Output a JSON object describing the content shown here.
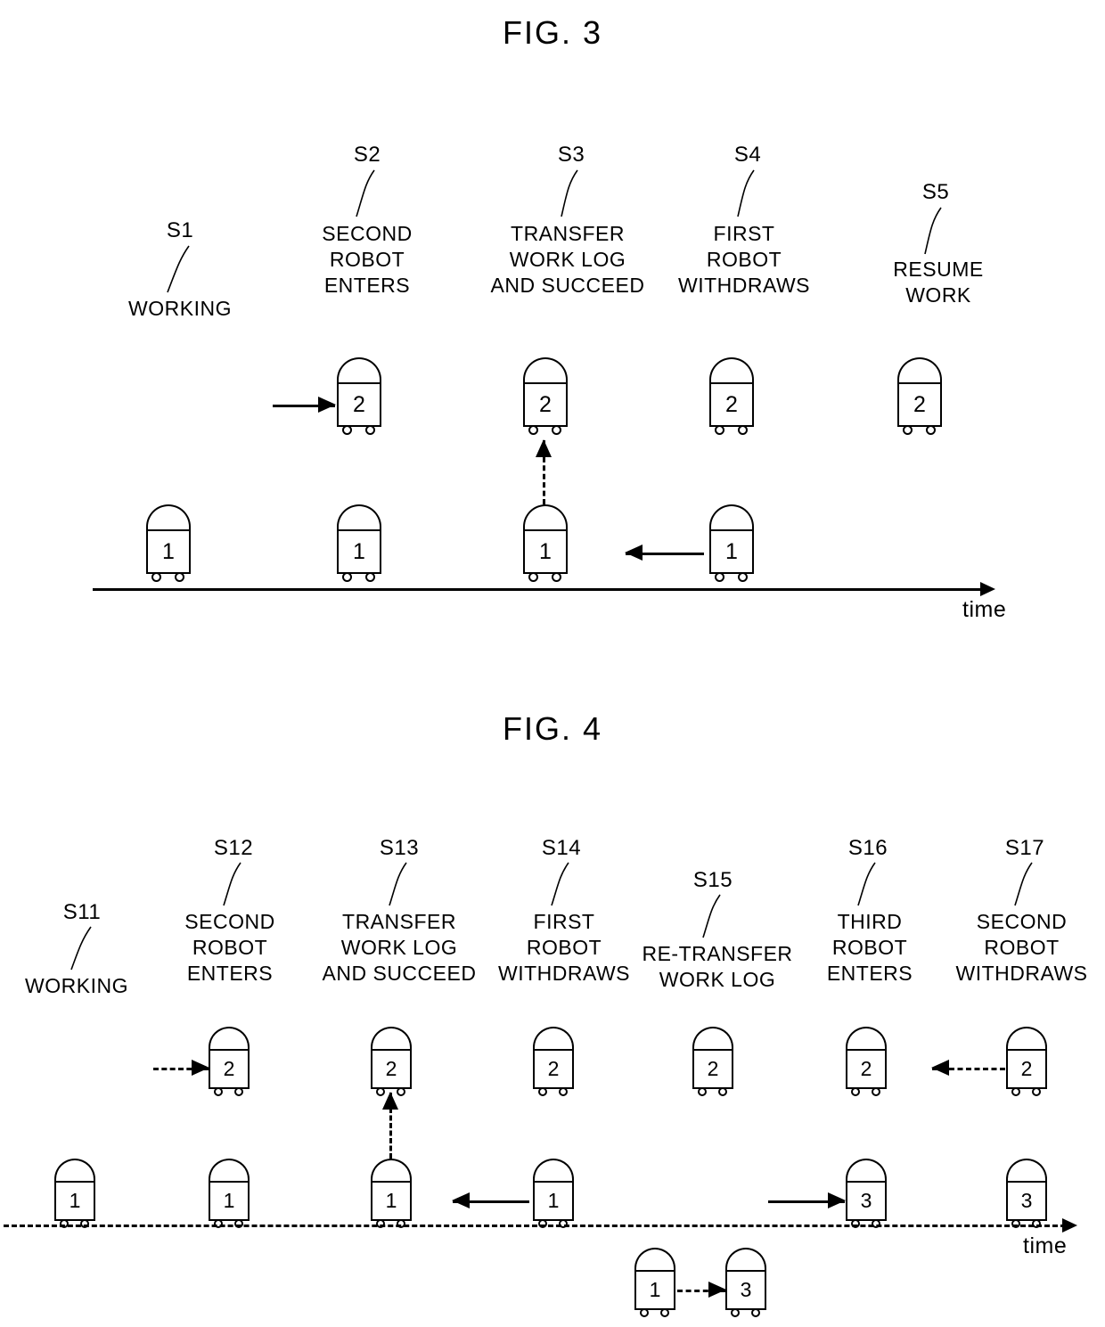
{
  "figures": [
    {
      "id": "fig3",
      "title": "FIG. 3",
      "time_axis_label": "time",
      "steps": [
        {
          "num": "S1",
          "label": "WORKING"
        },
        {
          "num": "S2",
          "label": "SECOND\nROBOT\nENTERS"
        },
        {
          "num": "S3",
          "label": "TRANSFER\nWORK LOG\nAND SUCCEED"
        },
        {
          "num": "S4",
          "label": "FIRST\nROBOT\nWITHDRAWS"
        },
        {
          "num": "S5",
          "label": "RESUME\nWORK"
        }
      ],
      "robots": {
        "upper": [
          "",
          "2",
          "2",
          "2",
          "2"
        ],
        "lower": [
          "1",
          "1",
          "1",
          "1",
          ""
        ]
      },
      "arrows": [
        {
          "name": "second-robot-enters-arrow",
          "dir": "right",
          "style": "solid"
        },
        {
          "name": "transfer-work-log-arrow",
          "dir": "up",
          "style": "dashed"
        },
        {
          "name": "first-robot-withdraws-arrow",
          "dir": "left",
          "style": "solid"
        }
      ]
    },
    {
      "id": "fig4",
      "title": "FIG. 4",
      "time_axis_label": "time",
      "steps": [
        {
          "num": "S11",
          "label": "WORKING"
        },
        {
          "num": "S12",
          "label": "SECOND\nROBOT\nENTERS"
        },
        {
          "num": "S13",
          "label": "TRANSFER\nWORK LOG\nAND SUCCEED"
        },
        {
          "num": "S14",
          "label": "FIRST\nROBOT\nWITHDRAWS"
        },
        {
          "num": "S15",
          "label": "RE-TRANSFER\nWORK LOG"
        },
        {
          "num": "S16",
          "label": "THIRD\nROBOT\nENTERS"
        },
        {
          "num": "S17",
          "label": "SECOND\nROBOT\nWITHDRAWS"
        }
      ],
      "robots": {
        "upper": [
          "",
          "2",
          "2",
          "2",
          "2",
          "2",
          "2"
        ],
        "lower": [
          "1",
          "1",
          "1",
          "1",
          "",
          "3",
          "3"
        ],
        "sub": [
          "1",
          "3"
        ]
      },
      "arrows": [
        {
          "name": "second-robot-enters-arrow",
          "dir": "right",
          "style": "dashed"
        },
        {
          "name": "transfer-work-log-arrow",
          "dir": "up",
          "style": "dashed"
        },
        {
          "name": "first-robot-withdraws-arrow",
          "dir": "left",
          "style": "solid"
        },
        {
          "name": "third-robot-enters-arrow",
          "dir": "right",
          "style": "solid"
        },
        {
          "name": "second-robot-withdraws-arrow",
          "dir": "left",
          "style": "dashed"
        },
        {
          "name": "re-transfer-work-log-arrow",
          "dir": "right",
          "style": "dashed"
        }
      ]
    }
  ]
}
